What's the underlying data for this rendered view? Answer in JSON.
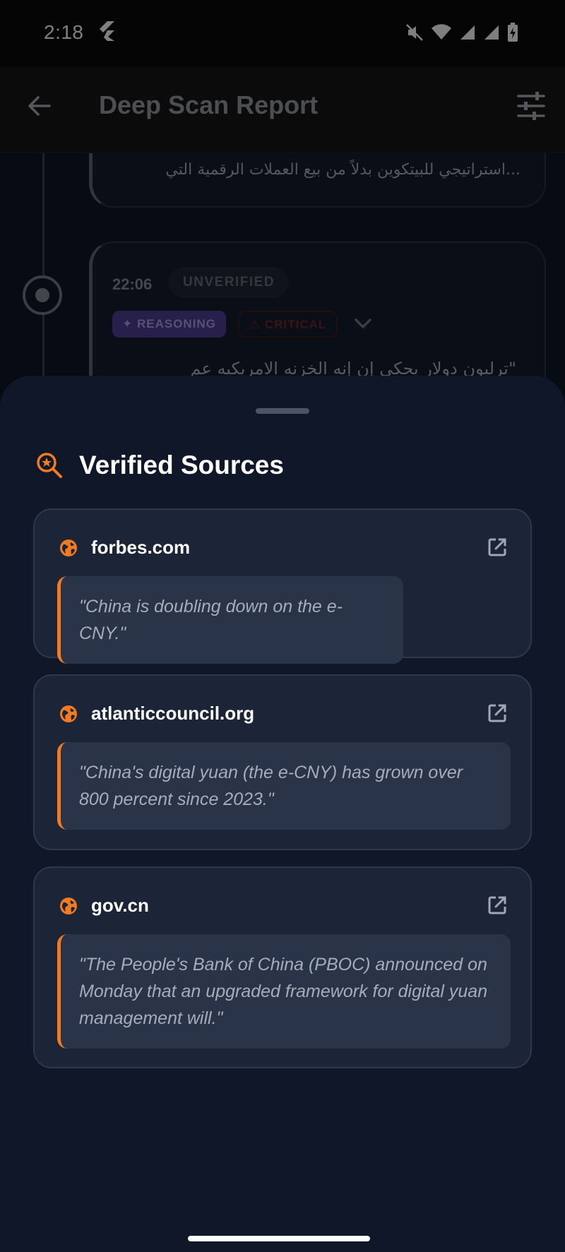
{
  "status_bar": {
    "time": "2:18"
  },
  "app_bar": {
    "title": "Deep Scan Report"
  },
  "timeline": {
    "previous_entry_text": "...استراتيجي للبيتكوين بدلاً من بيع العملات الرقمية التي",
    "entry": {
      "time": "22:06",
      "status_badge": "UNVERIFIED",
      "tag_reasoning": "REASONING",
      "tag_critical": "CRITICAL",
      "quote_preview": "\"ترليون دولار يحكي إن إنه الخزنه الامريكيه عم"
    }
  },
  "sheet": {
    "title": "Verified Sources",
    "accent_color": "#f07b22",
    "sources": [
      {
        "domain": "forbes.com",
        "quote": "\"China is doubling down on the e-CNY.\""
      },
      {
        "domain": "atlanticcouncil.org",
        "quote": "\"China's digital yuan (the e-CNY) has grown over 800 percent since 2023.\""
      },
      {
        "domain": "gov.cn",
        "quote": "\"The People's Bank of China (PBOC) announced on Monday that an upgraded framework for digital yuan management will.\""
      }
    ]
  }
}
